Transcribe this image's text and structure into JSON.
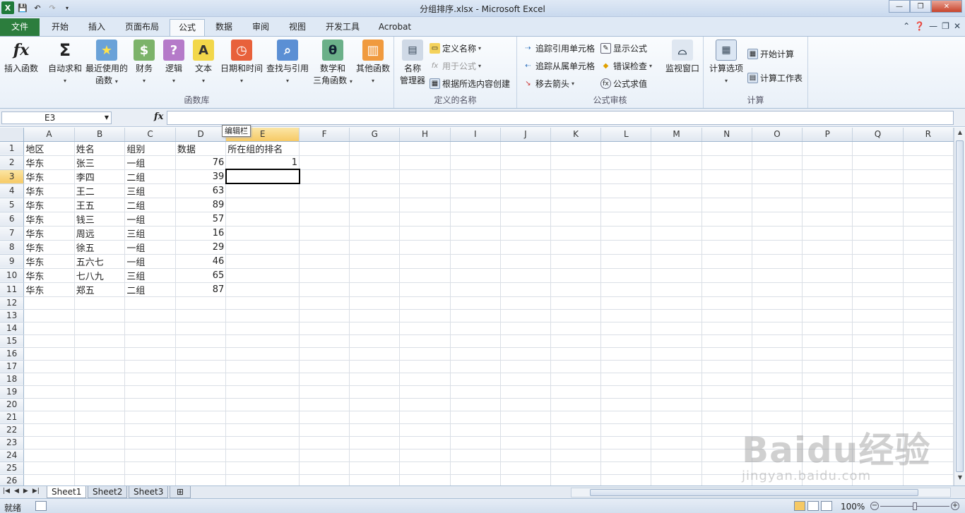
{
  "window": {
    "title": "分组排序.xlsx - Microsoft Excel",
    "minimize": "—",
    "restore": "❐",
    "close": "✕"
  },
  "tabs": [
    "文件",
    "开始",
    "插入",
    "页面布局",
    "公式",
    "数据",
    "审阅",
    "视图",
    "开发工具",
    "Acrobat"
  ],
  "ribbon": {
    "function_library": {
      "label": "函数库",
      "insert_function": "插入函数",
      "autosum": "自动求和",
      "recent_l1": "最近使用的",
      "recent_l2": "函数",
      "financial": "财务",
      "logical": "逻辑",
      "text": "文本",
      "datetime": "日期和时间",
      "lookup": "查找与引用",
      "math_l1": "数学和",
      "math_l2": "三角函数",
      "more": "其他函数"
    },
    "defined_names": {
      "label": "定义的名称",
      "name_manager_l1": "名称",
      "name_manager_l2": "管理器",
      "define_name": "定义名称",
      "use_in_formula": "用于公式",
      "create_from_selection": "根据所选内容创建"
    },
    "formula_auditing": {
      "label": "公式审核",
      "trace_precedents": "追踪引用单元格",
      "trace_dependents": "追踪从属单元格",
      "remove_arrows": "移去箭头",
      "show_formulas": "显示公式",
      "error_checking": "错误检查",
      "evaluate_formula": "公式求值",
      "watch_window": "监视窗口"
    },
    "calculation": {
      "label": "计算",
      "options": "计算选项",
      "calc_now": "开始计算",
      "calc_sheet": "计算工作表"
    }
  },
  "formula_bar": {
    "name_box": "E3",
    "fx": "fx",
    "tooltip": "编辑栏"
  },
  "columns": [
    "A",
    "B",
    "C",
    "D",
    "E",
    "F",
    "G",
    "H",
    "I",
    "J",
    "K",
    "L",
    "M",
    "N",
    "O",
    "P",
    "Q",
    "R"
  ],
  "rows": [
    [
      "地区",
      "姓名",
      "组别",
      "数据",
      "所在组的排名"
    ],
    [
      "华东",
      "张三",
      "一组",
      "76",
      "1"
    ],
    [
      "华东",
      "李四",
      "二组",
      "39",
      ""
    ],
    [
      "华东",
      "王二",
      "三组",
      "63",
      ""
    ],
    [
      "华东",
      "王五",
      "二组",
      "89",
      ""
    ],
    [
      "华东",
      "钱三",
      "一组",
      "57",
      ""
    ],
    [
      "华东",
      "周远",
      "三组",
      "16",
      ""
    ],
    [
      "华东",
      "徐五",
      "一组",
      "29",
      ""
    ],
    [
      "华东",
      "五六七",
      "一组",
      "46",
      ""
    ],
    [
      "华东",
      "七八九",
      "三组",
      "65",
      ""
    ],
    [
      "华东",
      "郑五",
      "二组",
      "87",
      ""
    ]
  ],
  "row_count": 27,
  "sheets": [
    "Sheet1",
    "Sheet2",
    "Sheet3"
  ],
  "status": {
    "ready": "就绪",
    "zoom": "100%"
  },
  "watermark": {
    "logo": "Baidu经验",
    "url": "jingyan.baidu.com"
  },
  "colors": {
    "file_tab": "#2c7d3d",
    "selected_header": "#f6c965",
    "gridline": "#dadfe6"
  }
}
